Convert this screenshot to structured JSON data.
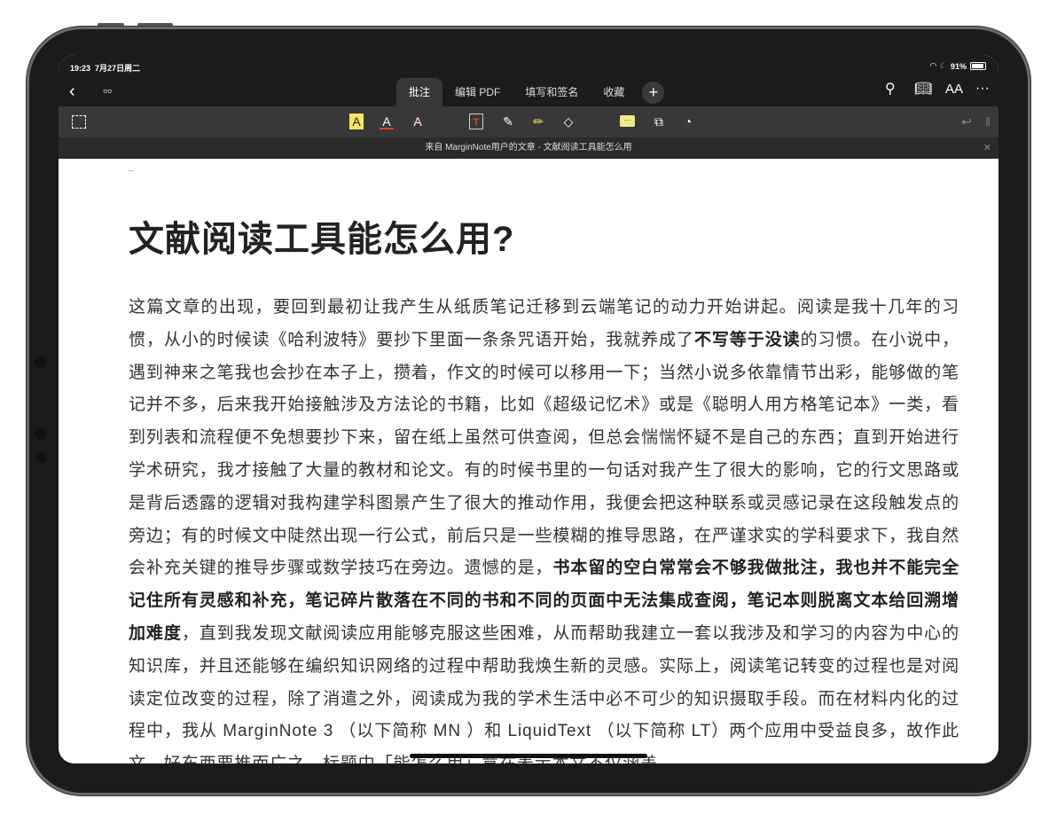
{
  "status": {
    "time": "19:23",
    "date": "7月27日周二",
    "battery": "91%"
  },
  "nav": {
    "tabs": [
      "批注",
      "编辑 PDF",
      "填写和签名",
      "收藏"
    ],
    "active_tab": 0,
    "font_label": "AA"
  },
  "toolbar": {
    "colors": {
      "highlight": "#f5e663",
      "red": "#e0442c"
    }
  },
  "banner": {
    "title": "来自 MarginNote用户的文章 - 文献阅读工具能怎么用"
  },
  "doc": {
    "title": "文献阅读工具能怎么用?",
    "segments": [
      {
        "text": "这篇文章的出现，要回到最初让我产生从纸质笔记迁移到云端笔记的动力开始讲起。阅读是我十几年的习惯，从小的时候读《哈利波特》要抄下里面一条条咒语开始，我就养成了",
        "bold": false
      },
      {
        "text": "不写等于没读",
        "bold": true
      },
      {
        "text": "的习惯。在小说中，遇到神来之笔我也会抄在本子上，攒着，作文的时候可以移用一下；当然小说多依靠情节出彩，能够做的笔记并不多，后来我开始接触涉及方法论的书籍，比如《超级记忆术》或是《聪明人用方格笔记本》一类，看到列表和流程便不免想要抄下来，留在纸上虽然可供查阅，但总会惴惴怀疑不是自己的东西；直到开始进行学术研究，我才接触了大量的教材和论文。有的时候书里的一句话对我产生了很大的影响，它的行文思路或是背后透露的逻辑对我构建学科图景产生了很大的推动作用，我便会把这种联系或灵感记录在这段触发点的旁边；有的时候文中陡然出现一行公式，前后只是一些模糊的推导思路，在严谨求实的学科要求下，我自然会补充关键的推导步骤或数学技巧在旁边。遗憾的是，",
        "bold": false
      },
      {
        "text": "书本留的空白常常会不够我做批注，我也并不能完全记住所有灵感和补充，笔记碎片散落在不同的书和不同的页面中无法集成查阅，笔记本则脱离文本给回溯增加难度",
        "bold": true
      },
      {
        "text": "，直到我发现文献阅读应用能够克服这些困难，从而帮助我建立一套以我涉及和学习的内容为中心的知识库，并且还能够在编织知识网络的过程中帮助我焕生新的灵感。实际上，阅读笔记转变的过程也是对阅读定位改变的过程，除了消遣之外，阅读成为我的学术生活中必不可少的知识摄取手段。而在材料内化的过程中，我从 MarginNote 3 （以下简称 MN ）和 LiquidText （以下简称 LT）两个应用中受益良多，故作此文，好东西要推而广之。标题中「能怎么用」意在表示本文不仅涵盖",
        "bold": false
      }
    ]
  }
}
